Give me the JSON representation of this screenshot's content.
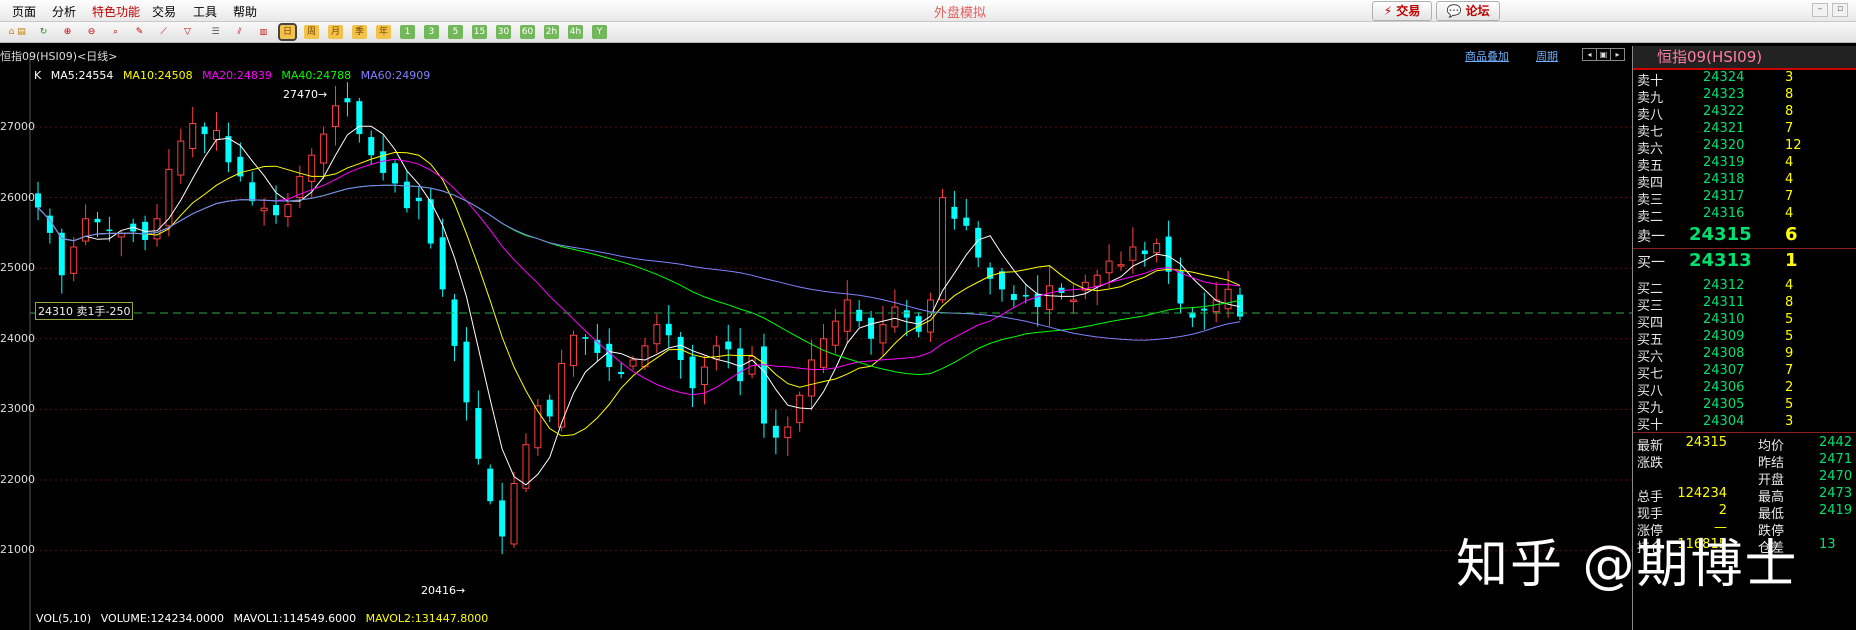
{
  "menu": {
    "items": [
      "页面",
      "分析",
      "特色功能",
      "交易",
      "工具",
      "帮助"
    ],
    "center_title": "外盘模拟",
    "trade_btn": "⚡ 交易",
    "forum_btn": "💬 论坛"
  },
  "toolbar": {
    "period_buttons": [
      "日",
      "周",
      "月",
      "季",
      "年",
      "1",
      "3",
      "5",
      "15",
      "30",
      "60",
      "2h",
      "4h",
      "Y"
    ],
    "selected": "日"
  },
  "chart": {
    "title": "恒指09(HSI09)<日线>",
    "overlay_link": "商品叠加",
    "period_link": "周期",
    "ma_legend": [
      {
        "text": "K",
        "color": "#ffffff"
      },
      {
        "text": "MA5:24554",
        "color": "#ffffff"
      },
      {
        "text": "MA10:24508",
        "color": "#ffff00"
      },
      {
        "text": "MA20:24839",
        "color": "#ff00ff"
      },
      {
        "text": "MA40:24788",
        "color": "#00ff00"
      },
      {
        "text": "MA60:24909",
        "color": "#8080ff"
      }
    ],
    "vol_legend": [
      {
        "text": "VOL(5,10)",
        "color": "#ffffff"
      },
      {
        "text": "VOLUME:124234.0000",
        "color": "#ffffff"
      },
      {
        "text": "MAVOL1:114549.6000",
        "color": "#ffffff"
      },
      {
        "text": "MAVOL2:131447.8000",
        "color": "#ffff00"
      }
    ],
    "y_labels": [
      "27000",
      "26000",
      "25000",
      "24000",
      "23000",
      "22000",
      "21000"
    ],
    "high_label": "27470→",
    "low_label": "20416→",
    "bid_tag": "24310 卖1手-250",
    "watermark": "知乎 @期博士"
  },
  "chart_data": {
    "type": "candlestick",
    "title": "恒指09(HSI09)<日线>",
    "ylim": [
      20100,
      27900
    ],
    "ma_values": {
      "MA5": 24554,
      "MA10": 24508,
      "MA20": 24839,
      "MA40": 24788,
      "MA60": 24909
    },
    "highest": 27470,
    "lowest": 20416,
    "last": 24315,
    "closes": [
      25860,
      25500,
      24900,
      25300,
      25700,
      25650,
      25540,
      25490,
      25520,
      25400,
      25700,
      26400,
      26800,
      27050,
      26900,
      26950,
      26500,
      26300,
      25950,
      25850,
      25750,
      25900,
      26300,
      26600,
      26900,
      27300,
      27350,
      26900,
      26600,
      26350,
      26200,
      25850,
      25950,
      25350,
      24700,
      23900,
      23100,
      22300,
      21700,
      21200,
      21950,
      22500,
      23050,
      22900,
      23650,
      24050,
      24000,
      23800,
      23600,
      23500,
      23700,
      23900,
      24200,
      24050,
      23700,
      23300,
      23600,
      23900,
      23850,
      23400,
      23750,
      22800,
      22600,
      22750,
      23200,
      23700,
      24000,
      24250,
      24550,
      24250,
      24000,
      24200,
      24450,
      24300,
      24100,
      24550,
      26000,
      25700,
      25600,
      25150,
      24850,
      24700,
      24550,
      24600,
      24450,
      24750,
      24650,
      24550,
      24800,
      24900,
      25100,
      25050,
      25300,
      25200,
      25350,
      24950,
      24500,
      24300,
      24400,
      24550,
      24700,
      24315
    ]
  },
  "quote": {
    "header": "恒指09(HSI09)",
    "asks": [
      {
        "label": "卖十",
        "price": "24324",
        "vol": "3"
      },
      {
        "label": "卖九",
        "price": "24323",
        "vol": "8"
      },
      {
        "label": "卖八",
        "price": "24322",
        "vol": "8"
      },
      {
        "label": "卖七",
        "price": "24321",
        "vol": "7"
      },
      {
        "label": "卖六",
        "price": "24320",
        "vol": "12"
      },
      {
        "label": "卖五",
        "price": "24319",
        "vol": "4"
      },
      {
        "label": "卖四",
        "price": "24318",
        "vol": "4"
      },
      {
        "label": "卖三",
        "price": "24317",
        "vol": "7"
      },
      {
        "label": "卖二",
        "price": "24316",
        "vol": "4"
      }
    ],
    "ask1": {
      "label": "卖一",
      "price": "24315",
      "vol": "6"
    },
    "bid1": {
      "label": "买一",
      "price": "24313",
      "vol": "1"
    },
    "bids": [
      {
        "label": "买二",
        "price": "24312",
        "vol": "4"
      },
      {
        "label": "买三",
        "price": "24311",
        "vol": "8"
      },
      {
        "label": "买四",
        "price": "24310",
        "vol": "5"
      },
      {
        "label": "买五",
        "price": "24309",
        "vol": "5"
      },
      {
        "label": "买六",
        "price": "24308",
        "vol": "9"
      },
      {
        "label": "买七",
        "price": "24307",
        "vol": "7"
      },
      {
        "label": "买八",
        "price": "24306",
        "vol": "2"
      },
      {
        "label": "买九",
        "price": "24305",
        "vol": "5"
      },
      {
        "label": "买十",
        "price": "24304",
        "vol": "3"
      }
    ],
    "stats": [
      {
        "l": "最新",
        "v": "24315",
        "l2": "均价",
        "v2": "2442"
      },
      {
        "l": "涨跌",
        "v": "",
        "l2": "昨结",
        "v2": "2471"
      },
      {
        "l": "",
        "v": "",
        "l2": "开盘",
        "v2": "2470"
      },
      {
        "l": "总手",
        "v": "124234",
        "l2": "最高",
        "v2": "2473"
      },
      {
        "l": "现手",
        "v": "2",
        "l2": "最低",
        "v2": "2419"
      },
      {
        "l": "涨停",
        "v": "—",
        "l2": "跌停",
        "v2": ""
      },
      {
        "l": "持仓",
        "v": "116815",
        "l2": "仓差",
        "v2": "13"
      }
    ]
  }
}
